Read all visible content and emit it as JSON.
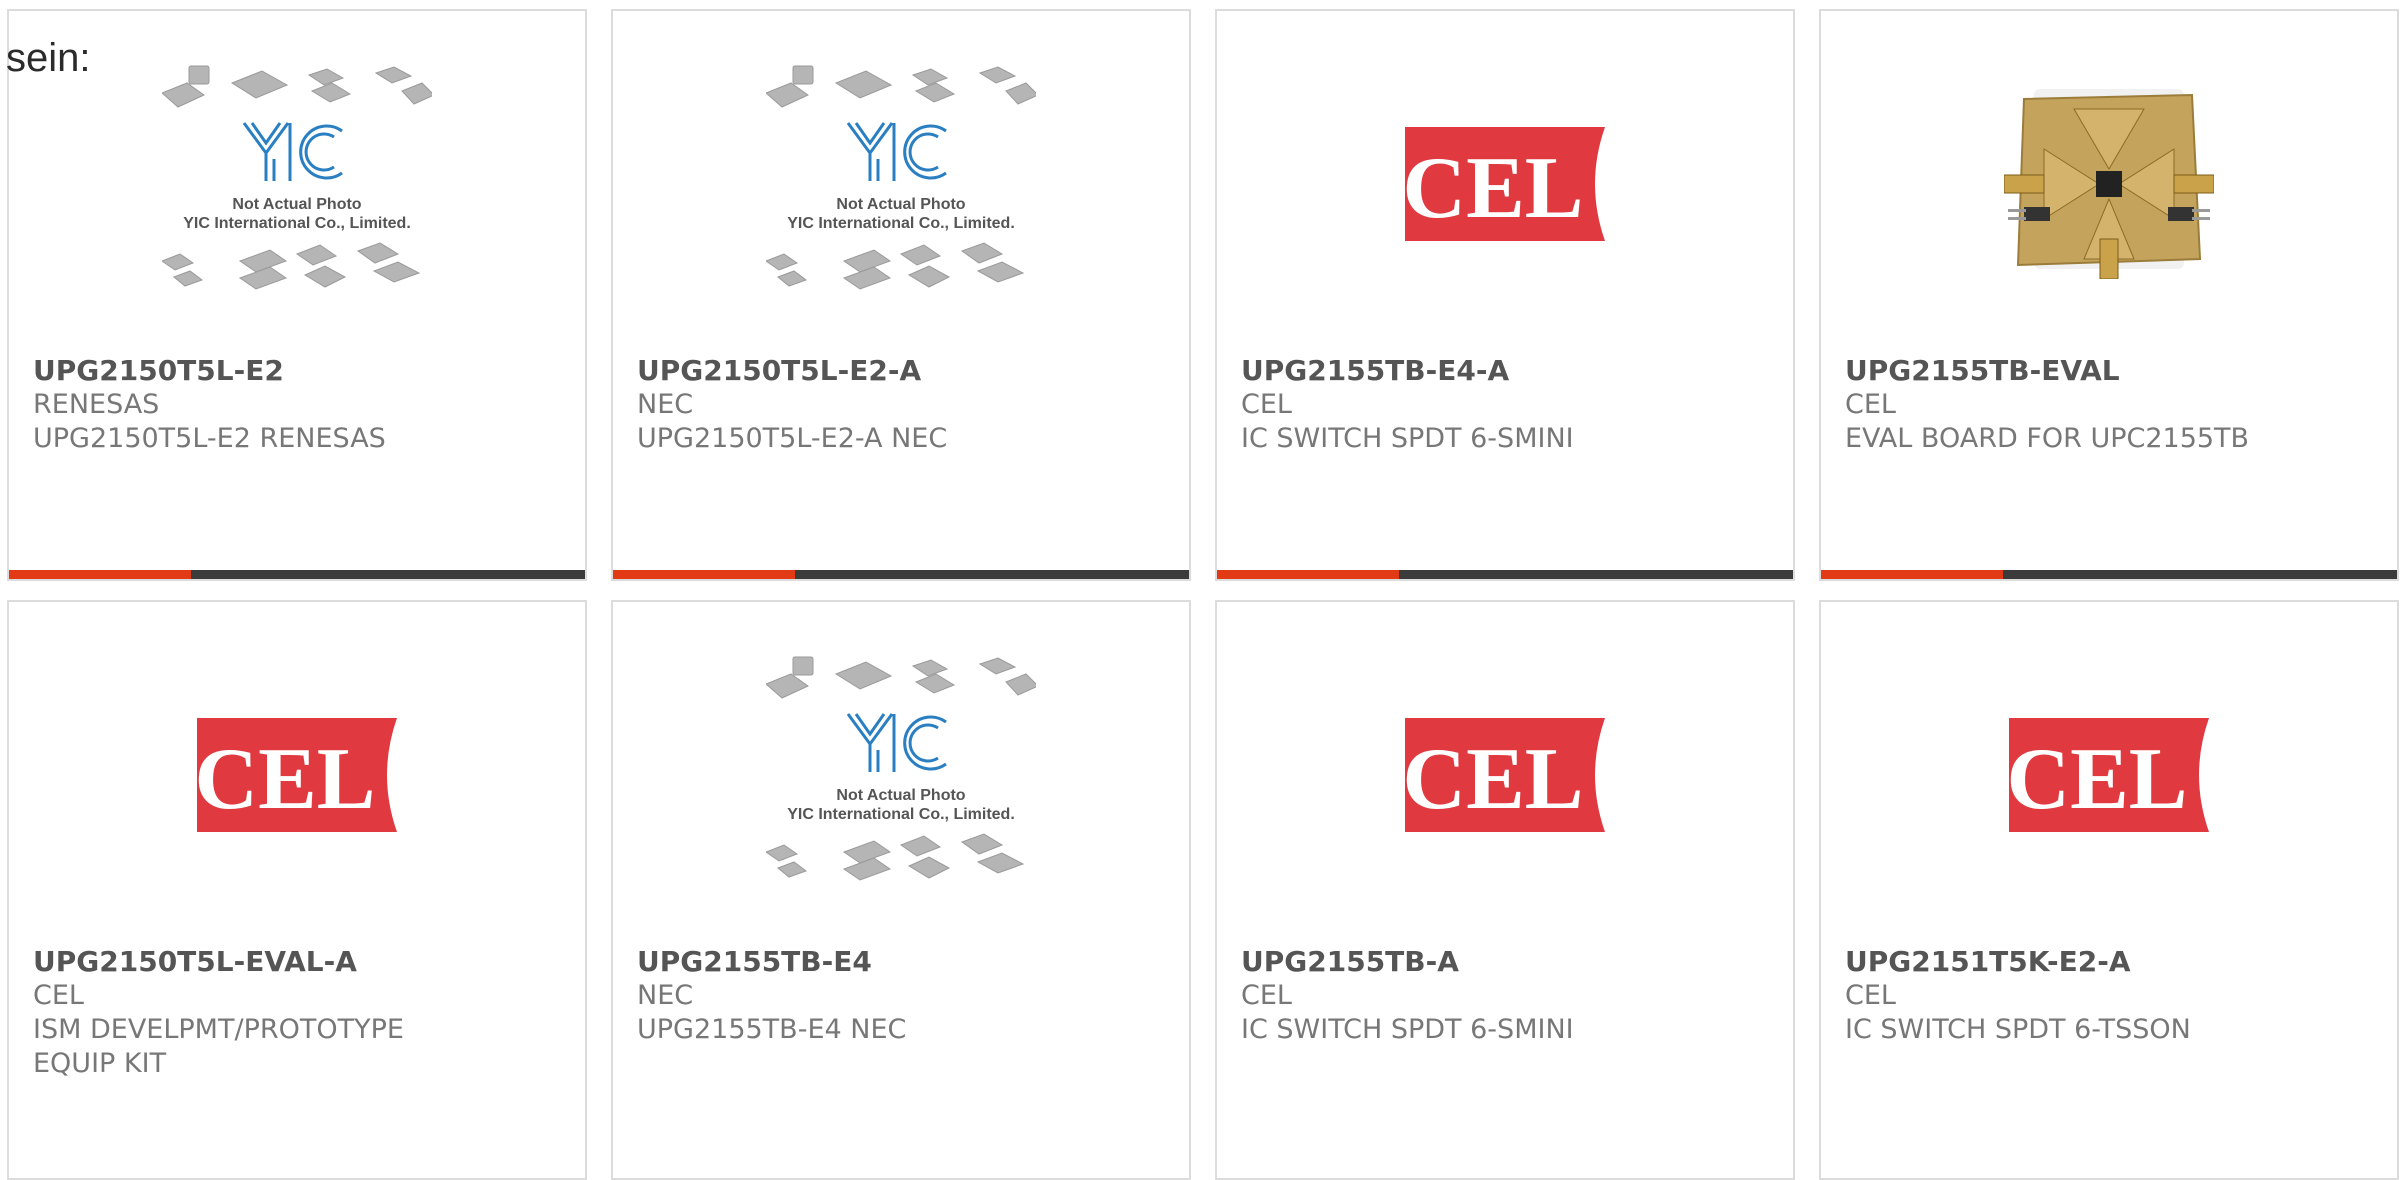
{
  "intro_text": "sein:",
  "colors": {
    "accent": "#e23a14",
    "bar": "#3b3b3b",
    "cel_red": "#e03a40",
    "yic_blue": "#2a7fc2"
  },
  "placeholder": {
    "line1": "Not Actual Photo",
    "line2": "YIC International Co., Limited."
  },
  "cel_logo_text": "CEL",
  "products": [
    {
      "part": "UPG2150T5L-E2",
      "manufacturer": "RENESAS",
      "description": "UPG2150T5L-E2 RENESAS",
      "image": "yic-placeholder"
    },
    {
      "part": "UPG2150T5L-E2-A",
      "manufacturer": "NEC",
      "description": "UPG2150T5L-E2-A NEC",
      "image": "yic-placeholder"
    },
    {
      "part": "UPG2155TB-E4-A",
      "manufacturer": "CEL",
      "description": "IC SWITCH SPDT 6-SMINI",
      "image": "cel-logo"
    },
    {
      "part": "UPG2155TB-EVAL",
      "manufacturer": "CEL",
      "description": "EVAL BOARD FOR UPC2155TB",
      "image": "eval-board-photo"
    },
    {
      "part": "UPG2150T5L-EVAL-A",
      "manufacturer": "CEL",
      "description": "ISM DEVELPMT/PROTOTYPE EQUIP KIT",
      "image": "cel-logo"
    },
    {
      "part": "UPG2155TB-E4",
      "manufacturer": "NEC",
      "description": "UPG2155TB-E4 NEC",
      "image": "yic-placeholder"
    },
    {
      "part": "UPG2155TB-A",
      "manufacturer": "CEL",
      "description": "IC SWITCH SPDT 6-SMINI",
      "image": "cel-logo"
    },
    {
      "part": "UPG2151T5K-E2-A",
      "manufacturer": "CEL",
      "description": "IC SWITCH SPDT 6-TSSON",
      "image": "cel-logo"
    }
  ]
}
